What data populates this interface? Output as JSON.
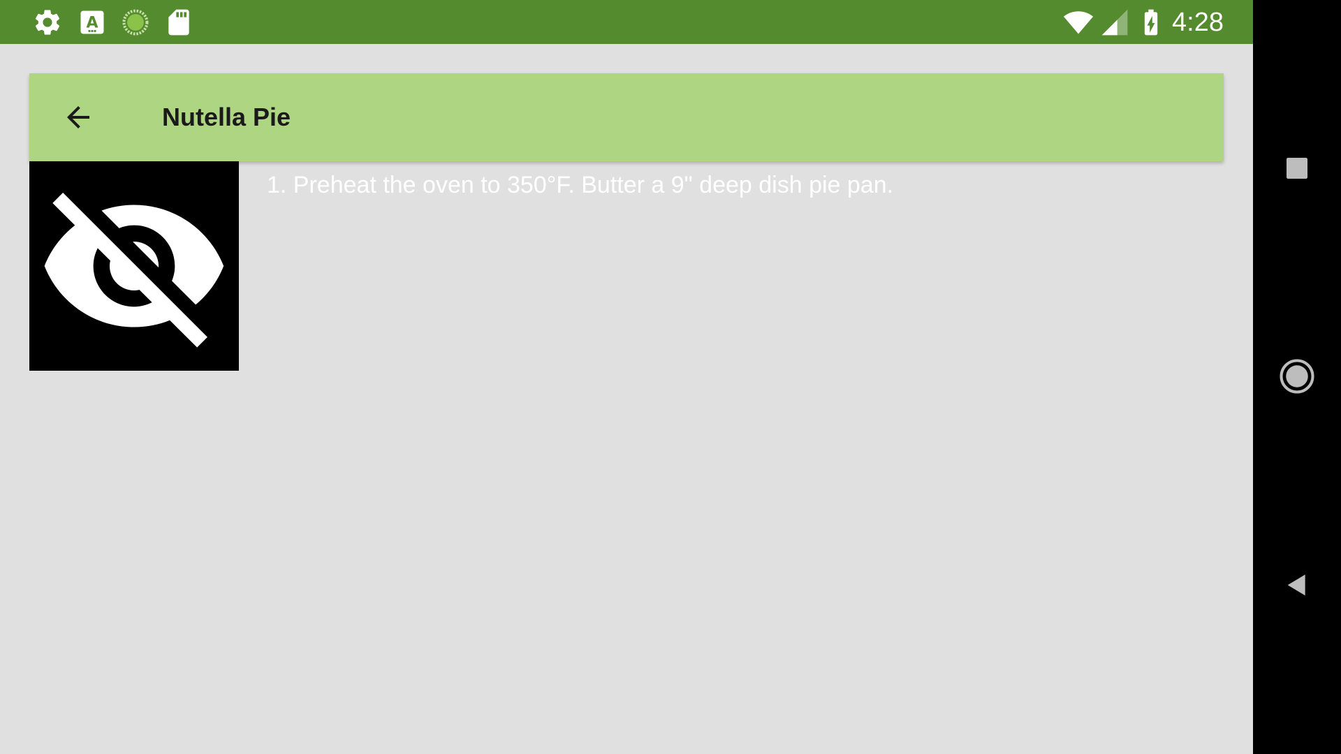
{
  "status_bar": {
    "time": "4:28",
    "background_color": "#558b2f",
    "left_icons": [
      "settings-icon",
      "keyboard-a-icon",
      "sync-progress-icon",
      "sd-card-icon"
    ],
    "right_icons": [
      "wifi-icon",
      "cell-signal-icon",
      "battery-charging-icon"
    ]
  },
  "toolbar": {
    "title": "Nutella Pie",
    "background_color": "#aed581",
    "back_icon": "arrow-back-icon"
  },
  "step": {
    "image_icon": "visibility-off-icon",
    "text": "1. Preheat the oven to 350°F. Butter a 9\" deep dish pie pan."
  },
  "navigation_bar": {
    "buttons": [
      "recents-button",
      "home-button",
      "back-button"
    ]
  }
}
